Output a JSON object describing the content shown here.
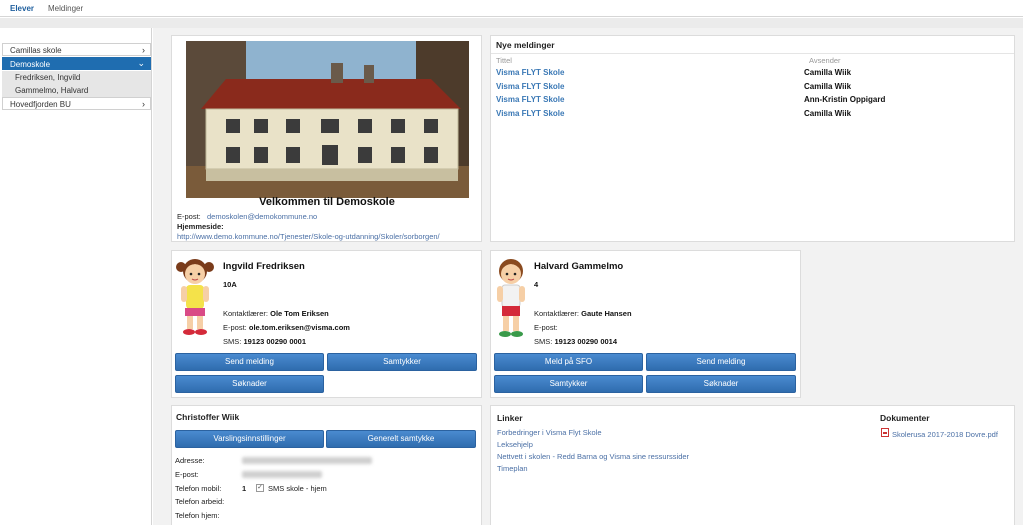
{
  "topnav": {
    "tabs": [
      {
        "label": "Elever"
      },
      {
        "label": "Meldinger"
      }
    ]
  },
  "sidebar": {
    "items": [
      {
        "label": "Camillas skole"
      },
      {
        "label": "Demoskole"
      },
      {
        "label": "Hovedfjorden BU"
      }
    ],
    "subitems": [
      {
        "label": "Fredriksen, Ingvild"
      },
      {
        "label": "Gammelmo, Halvard"
      }
    ]
  },
  "school": {
    "welcome": "Velkommen til Demoskole",
    "email_label": "E-post:",
    "email": "demoskolen@demokommune.no",
    "homepage_label": "Hjemmeside:",
    "homepage": "http://www.demo.kommune.no/Tjenester/Skole-og-utdanning/Skoler/sorborgen/"
  },
  "messages": {
    "heading": "Nye meldinger",
    "col_title": "Tittel",
    "col_sender": "Avsender",
    "rows": [
      {
        "title": "Visma FLYT Skole",
        "sender": "Camilla Wiik"
      },
      {
        "title": "Visma FLYT Skole",
        "sender": "Camilla Wiik"
      },
      {
        "title": "Visma FLYT Skole",
        "sender": "Ann-Kristin Oppigard"
      },
      {
        "title": "Visma FLYT Skole",
        "sender": "Camilla Wiik"
      }
    ]
  },
  "students": [
    {
      "name": "Ingvild Fredriksen",
      "class": "10A",
      "contact_label": "Kontaktlærer:",
      "contact": "Ole Tom Eriksen",
      "email_label": "E-post:",
      "email": "ole.tom.eriksen@visma.com",
      "sms_label": "SMS:",
      "sms": "19123 00290 0001",
      "buttons": [
        "Send melding",
        "Samtykker",
        "Søknader"
      ]
    },
    {
      "name": "Halvard Gammelmo",
      "class": "4",
      "contact_label": "Kontaktlærer:",
      "contact": "Gaute Hansen",
      "email_label": "E-post:",
      "email": "",
      "sms_label": "SMS:",
      "sms": "19123 00290 0014",
      "buttons": [
        "Meld på SFO",
        "Send melding",
        "Samtykker",
        "Søknader"
      ]
    }
  ],
  "guardian": {
    "name": "Christoffer Wiik",
    "buttons": [
      "Varslingsinnstillinger",
      "Generelt samtykke"
    ],
    "address_label": "Adresse:",
    "email_label": "E-post:",
    "mobile_label": "Telefon mobil:",
    "mobile_value": "1",
    "sms_option": "SMS skole - hjem",
    "work_label": "Telefon arbeid:",
    "home_label": "Telefon hjem:"
  },
  "links": {
    "heading": "Linker",
    "items": [
      "Forbedringer i Visma Flyt Skole",
      "Leksehjelp",
      "Nettvett i skolen - Redd Barna og Visma sine ressurssider",
      "Timeplan"
    ]
  },
  "documents": {
    "heading": "Dokumenter",
    "items": [
      "Skolerusa 2017-2018 Dovre.pdf"
    ]
  },
  "colors": {
    "accent": "#1f6db0",
    "button": "#3a7cc1",
    "link": "#4a6fa5"
  }
}
